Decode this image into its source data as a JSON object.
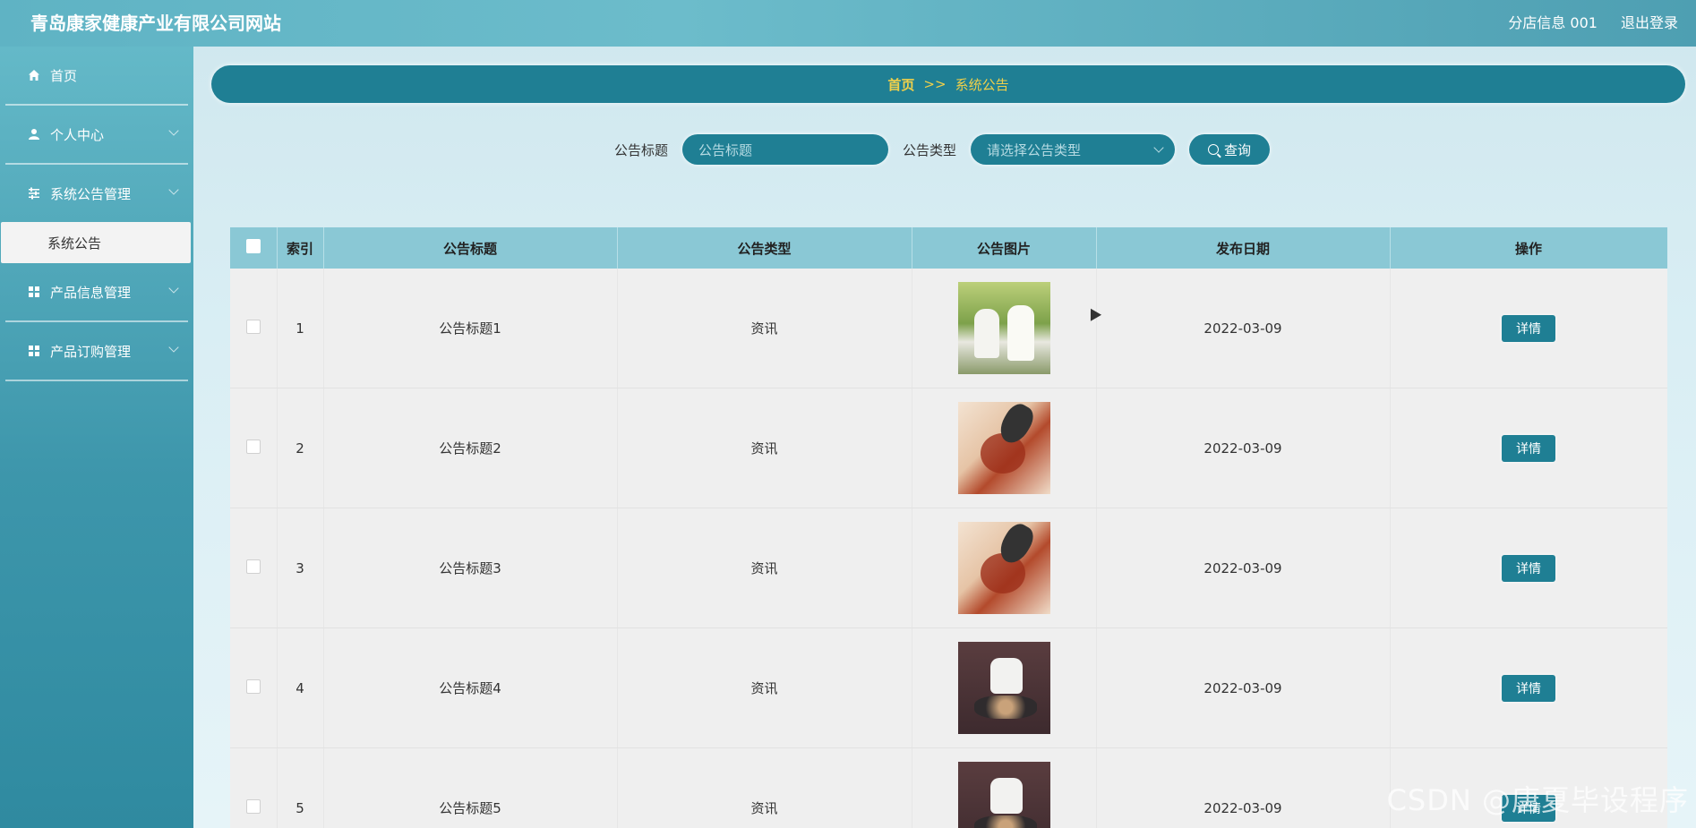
{
  "header": {
    "site_title": "青岛康家健康产业有限公司网站",
    "user_label": "分店信息 001",
    "logout_label": "退出登录"
  },
  "sidebar": {
    "items": [
      {
        "label": "首页",
        "icon": "home-icon"
      },
      {
        "label": "个人中心",
        "icon": "user-icon"
      },
      {
        "label": "系统公告管理",
        "icon": "sliders-icon"
      },
      {
        "label": "产品信息管理",
        "icon": "grid-icon"
      },
      {
        "label": "产品订购管理",
        "icon": "grid-icon"
      }
    ],
    "active_sub": "系统公告"
  },
  "breadcrumb": {
    "home": "首页",
    "separator": ">>",
    "current": "系统公告"
  },
  "search": {
    "title_label": "公告标题",
    "title_placeholder": "公告标题",
    "type_label": "公告类型",
    "type_placeholder": "请选择公告类型",
    "query_label": "查询"
  },
  "table": {
    "headers": [
      "索引",
      "公告标题",
      "公告类型",
      "公告图片",
      "发布日期",
      "操作"
    ],
    "rows": [
      {
        "index": "1",
        "title": "公告标题1",
        "type": "资讯",
        "date": "2022-03-09",
        "image": "elderly-couple-photo",
        "action": "详情"
      },
      {
        "index": "2",
        "title": "公告标题2",
        "type": "资讯",
        "date": "2022-03-09",
        "image": "food-photo",
        "action": "详情"
      },
      {
        "index": "3",
        "title": "公告标题3",
        "type": "资讯",
        "date": "2022-03-09",
        "image": "food-photo",
        "action": "详情"
      },
      {
        "index": "4",
        "title": "公告标题4",
        "type": "资讯",
        "date": "2022-03-09",
        "image": "tea-pot-photo",
        "action": "详情"
      },
      {
        "index": "5",
        "title": "公告标题5",
        "type": "资讯",
        "date": "2022-03-09",
        "image": "tea-pot-photo",
        "action": "详情"
      }
    ]
  },
  "watermark": "CSDN @唐夏毕设程序",
  "colors": {
    "accent": "#1f7f94",
    "header_th": "#8ac8d5",
    "breadcrumb_text": "#f0d04a"
  }
}
